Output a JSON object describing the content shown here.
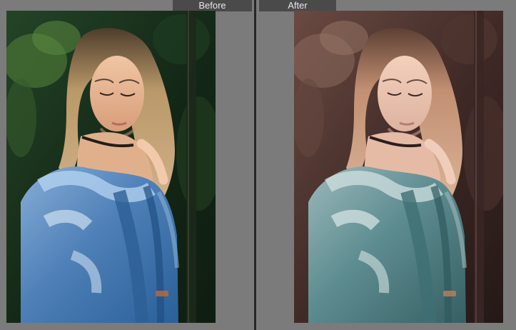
{
  "compare_view": {
    "before_label": "Before",
    "after_label": "After"
  },
  "colors": {
    "before_background": "#1f3a1d",
    "after_background": "#4a312d",
    "before_jacket": "#4d7bb2",
    "after_jacket": "#5c8c8f",
    "before_hair": "#b99869",
    "after_hair": "#c28f72"
  }
}
